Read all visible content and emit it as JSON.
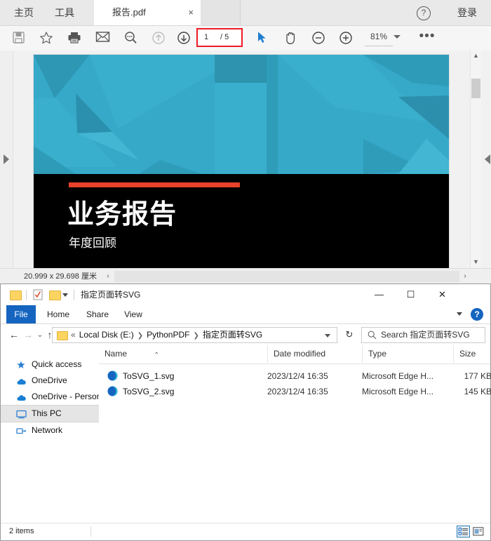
{
  "pdf_reader": {
    "menu": [
      {
        "label": "主页",
        "name": "menu-home"
      },
      {
        "label": "工具",
        "name": "menu-tools"
      }
    ],
    "document_tab": {
      "label": "报告.pdf",
      "close": "×"
    },
    "help_icon": "?",
    "signin_label": "登录",
    "toolbar": {
      "icons": [
        {
          "name": "save-icon",
          "title": "保存"
        },
        {
          "name": "star-icon",
          "title": "收藏"
        },
        {
          "name": "print-icon",
          "title": "打印"
        },
        {
          "name": "email-icon",
          "title": "邮件"
        },
        {
          "name": "search-icon",
          "title": "搜索"
        },
        {
          "name": "previous-page-icon",
          "title": "上一页"
        },
        {
          "name": "next-page-icon",
          "title": "下一页"
        },
        {
          "name": "select-tool-icon",
          "title": "选择"
        },
        {
          "name": "hand-tool-icon",
          "title": "手形工具"
        },
        {
          "name": "zoom-out-icon",
          "title": "缩小"
        },
        {
          "name": "zoom-in-icon",
          "title": "放大"
        }
      ],
      "page_current": "1",
      "page_total": "/ 5",
      "zoom_value": "81%",
      "more_label": "•••"
    },
    "page": {
      "title": "业务报告",
      "subtitle": "年度回顾",
      "hero_color": "#36a9c9",
      "accent_color": "#e8412c",
      "background_color": "#000000"
    },
    "status": {
      "page_size": "20.999 x 29.698 厘米",
      "scroll_left": "‹",
      "scroll_right": "›"
    }
  },
  "file_explorer": {
    "title": "指定页面转SVG",
    "quick_access": [
      {
        "name": "qat-folder-icon"
      },
      {
        "name": "qat-properties-icon"
      },
      {
        "name": "qat-new-folder-icon"
      }
    ],
    "window_buttons": [
      {
        "label": "—",
        "name": "minimize-button"
      },
      {
        "label": "☐",
        "name": "maximize-button"
      },
      {
        "label": "✕",
        "name": "close-button"
      }
    ],
    "ribbon_tabs": [
      {
        "label": "File",
        "name": "ribbon-tab-file"
      },
      {
        "label": "Home",
        "name": "ribbon-tab-home"
      },
      {
        "label": "Share",
        "name": "ribbon-tab-share"
      },
      {
        "label": "View",
        "name": "ribbon-tab-view"
      }
    ],
    "ribbon_help": "?",
    "address": {
      "back": "←",
      "forward": "→",
      "recent": "⌄",
      "up": "↑",
      "overflow": "«",
      "crumbs": [
        "Local Disk (E:)",
        "PythonPDF",
        "指定页面转SVG"
      ],
      "refresh": "↻"
    },
    "search": {
      "placeholder": "Search 指定页面转SVG"
    },
    "nav_pane": [
      {
        "label": "Quick access",
        "icon": "star-icon",
        "selected": false
      },
      {
        "label": "OneDrive",
        "icon": "cloud-icon",
        "selected": false
      },
      {
        "label": "OneDrive - Personal",
        "icon": "cloud-icon",
        "selected": false
      },
      {
        "label": "This PC",
        "icon": "computer-icon",
        "selected": true
      },
      {
        "label": "Network",
        "icon": "network-icon",
        "selected": false
      }
    ],
    "columns": [
      {
        "label": "Name",
        "name": "column-name"
      },
      {
        "label": "Date modified",
        "name": "column-date-modified"
      },
      {
        "label": "Type",
        "name": "column-type"
      },
      {
        "label": "Size",
        "name": "column-size"
      }
    ],
    "sort_indicator": "⌃",
    "files": [
      {
        "name": "ToSVG_1.svg",
        "date": "2023/12/4 16:35",
        "type": "Microsoft Edge H...",
        "size": "177 KB"
      },
      {
        "name": "ToSVG_2.svg",
        "date": "2023/12/4 16:35",
        "type": "Microsoft Edge H...",
        "size": "145 KB"
      }
    ],
    "status": {
      "count": "2 items"
    },
    "view_buttons": [
      {
        "name": "details-view-button",
        "active": true
      },
      {
        "name": "large-icons-view-button",
        "active": false
      }
    ]
  }
}
